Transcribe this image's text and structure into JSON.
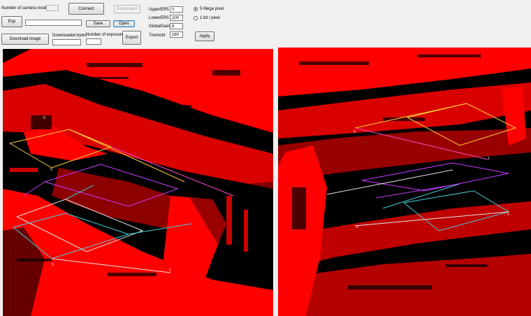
{
  "toolbar": {
    "camera_count_label": "Number of camera module:",
    "camera_count_value": "",
    "connect_label": "Connect",
    "disconnect_label": "Disconnect",
    "exp_label": "Exp",
    "path_value": "",
    "save_label": "Save",
    "open_label": "Open",
    "download_label": "Download image",
    "downloaded_bytes_label": "Downloaded bytes",
    "downloaded_bytes_value": "",
    "exposures_label": "Number of exposures:",
    "exposures_value": "",
    "export_label": "Export"
  },
  "settings": {
    "upper_ers_label": "UpperERS",
    "upper_ers_value": "0",
    "lower_ers_label": "LowerERS",
    "lower_ers_value": "200",
    "global_gain_label": "GlobalGain",
    "global_gain_value": "8",
    "threshold_label": "Treshold",
    "threshold_value": "180",
    "mode_5mp_label": "5 Mega pixel",
    "mode_1bit_label": "1 bit / pixel",
    "selected_mode": "5mp",
    "apply_label": "Apply"
  },
  "colors": {
    "image_foreground": "#ff0000",
    "image_background": "#000000",
    "overlay_yellow": "#ffd23c",
    "overlay_magenta": "#c83cff",
    "overlay_cyan": "#46d2dc",
    "overlay_white": "#e6e6e6"
  }
}
